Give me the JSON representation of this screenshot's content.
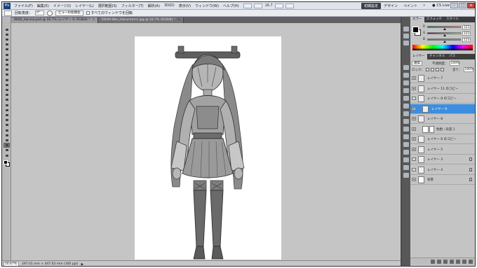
{
  "menu": {
    "logo": "Ps",
    "items": [
      "ファイル(F)",
      "編集(E)",
      "イメージ(I)",
      "レイヤー(L)",
      "選択範囲(S)",
      "フィルター(T)",
      "解析(A)",
      "3D(D)",
      "表示(V)",
      "ウィンドウ(W)",
      "ヘルプ(H)"
    ],
    "zoom": "16.7",
    "workspace_active": "初期設定",
    "workspaces": [
      "デザイン",
      "ペイント",
      "»"
    ],
    "cs_live": "CS Live",
    "window_buttons": [
      "–",
      "□",
      "×"
    ]
  },
  "options": {
    "rotate_label": "回転角度：",
    "rotate_value": "0°",
    "reset_view_button": "ビューの初期化",
    "all_windows_label": "すべてのウィンドウを回転"
  },
  "tabs": [
    {
      "label": "9040_haruna.psd @ 16.7% (レイヤー 9, RGB/8) *",
      "close": "×"
    },
    {
      "label": "59040 Bbn_Haruna(mr) jpg @ 16.7% (RGB/8) *",
      "close": "×"
    }
  ],
  "status": {
    "zoom": "16.67%",
    "doc_info": "297.01 mm × 447.63 mm (300 ppi)",
    "arrow": "▶"
  },
  "color_panel": {
    "tabs": [
      "カラー",
      "スウォッチ",
      "スタイル"
    ],
    "channels": [
      {
        "name": "R",
        "value": "123",
        "knob": 0.48
      },
      {
        "name": "G",
        "value": "123",
        "knob": 0.48
      },
      {
        "name": "B",
        "value": "123",
        "knob": 0.48
      }
    ]
  },
  "layers_panel": {
    "tabs": [
      "レイヤー",
      "チャンネル",
      "パス"
    ],
    "blend_mode": "通常",
    "opacity_label": "不透明度：",
    "opacity_value": "100%",
    "lock_label": "ロック：",
    "fill_label": "塗り：",
    "fill_value": "100%",
    "layers": [
      {
        "name": "レイヤー 7",
        "visible": true,
        "selected": false,
        "thumb": "checker",
        "mask": false,
        "locked": false,
        "indent": false
      },
      {
        "name": "レイヤー 11 のコピー",
        "visible": true,
        "selected": false,
        "thumb": "checker",
        "mask": false,
        "locked": false,
        "indent": false
      },
      {
        "name": "レイヤー 8 のコピー",
        "visible": false,
        "selected": false,
        "thumb": "checker",
        "mask": false,
        "locked": false,
        "indent": false
      },
      {
        "name": "レイヤー 9",
        "visible": true,
        "selected": true,
        "thumb": "checker",
        "mask": false,
        "locked": false,
        "indent": true
      },
      {
        "name": "レイヤー 8",
        "visible": true,
        "selected": false,
        "thumb": "checker",
        "mask": false,
        "locked": false,
        "indent": false
      },
      {
        "name": "色相・彩度 1",
        "visible": true,
        "selected": false,
        "thumb": "white",
        "mask": true,
        "locked": false,
        "indent": true
      },
      {
        "name": "レイヤー 6 のコピー",
        "visible": true,
        "selected": false,
        "thumb": "checker",
        "mask": false,
        "locked": false,
        "indent": false
      },
      {
        "name": "レイヤー 5",
        "visible": true,
        "selected": false,
        "thumb": "checker",
        "mask": false,
        "locked": false,
        "indent": false
      },
      {
        "name": "レイヤー 3",
        "visible": false,
        "selected": false,
        "thumb": "checker",
        "mask": false,
        "locked": true,
        "indent": false
      },
      {
        "name": "レイヤー 4",
        "visible": false,
        "selected": false,
        "thumb": "checker",
        "mask": false,
        "locked": true,
        "indent": false
      },
      {
        "name": "背景",
        "visible": true,
        "selected": false,
        "thumb": "white",
        "mask": false,
        "locked": true,
        "indent": false
      }
    ]
  },
  "toolbox": {
    "selected_index": 23
  },
  "icons": {
    "app_logo": "photoshop-logo-icon",
    "rotate_view": "rotate-view-icon",
    "eye": "eye-icon",
    "lock": "lock-icon"
  }
}
